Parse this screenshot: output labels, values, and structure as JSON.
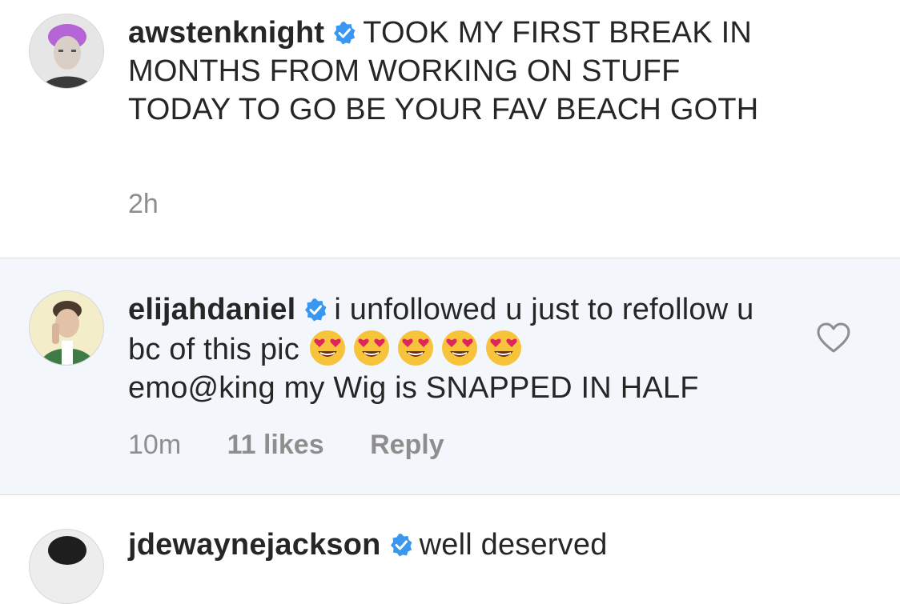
{
  "comments": [
    {
      "username": "awstenknight",
      "verified": true,
      "text": "TOOK MY FIRST BREAK IN MONTHS FROM WORKING ON STUFF TODAY TO GO BE YOUR FAV BEACH GOTH",
      "time": "2h"
    },
    {
      "username": "elijahdaniel",
      "verified": true,
      "text_before_emoji": "i unfollowed u just to refollow u bc of this pic",
      "emoji": [
        "heart-eyes-emoji",
        "heart-eyes-emoji",
        "heart-eyes-emoji",
        "heart-eyes-emoji",
        "heart-eyes-emoji"
      ],
      "text_after_emoji": "emo@king my Wig is SNAPPED IN HALF",
      "time": "10m",
      "likes": "11 likes",
      "reply_label": "Reply"
    },
    {
      "username": "jdewaynejackson",
      "verified": true,
      "text": "well deserved"
    }
  ],
  "colors": {
    "verified_badge": "#3897f0",
    "highlight_background": "#f3f7fb",
    "meta_text": "#8e8e8e"
  }
}
